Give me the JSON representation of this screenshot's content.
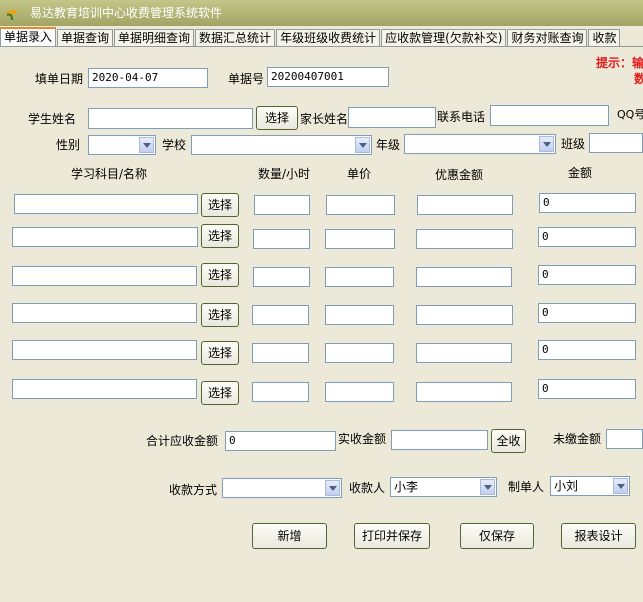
{
  "window": {
    "title": "易达教育培训中心收费管理系统软件"
  },
  "tabs": [
    "单据录入",
    "单据查询",
    "单据明细查询",
    "数据汇总统计",
    "年级班级收费统计",
    "应收款管理(欠款补交)",
    "财务对账查询",
    "收款"
  ],
  "form": {
    "date_label": "填单日期",
    "date_value": "2020-04-07",
    "receipt_label": "单据号",
    "receipt_value": "20200407001",
    "hint_line1": "提示：输",
    "hint_line2": "数",
    "student_label": "学生姓名",
    "student_value": "",
    "select_label": "选择",
    "parent_label": "家长姓名",
    "parent_value": "",
    "phone_label": "联系电话",
    "phone_value": "",
    "qq_label": "QQ号",
    "gender_label": "性别",
    "gender_value": "",
    "school_label": "学校",
    "school_value": "",
    "grade_label": "年级",
    "grade_value": "",
    "class_label": "班级",
    "class_value": ""
  },
  "items": {
    "headers": {
      "subject": "学习科目/名称",
      "qty": "数量/小时",
      "price": "单价",
      "discount": "优惠金额",
      "amount": "金额"
    },
    "rows": [
      {
        "subject": "",
        "select": "选择",
        "qty": "",
        "price": "",
        "discount": "",
        "amount": "0"
      },
      {
        "subject": "",
        "select": "选择",
        "qty": "",
        "price": "",
        "discount": "",
        "amount": "0"
      },
      {
        "subject": "",
        "select": "选择",
        "qty": "",
        "price": "",
        "discount": "",
        "amount": "0"
      },
      {
        "subject": "",
        "select": "选择",
        "qty": "",
        "price": "",
        "discount": "",
        "amount": "0"
      },
      {
        "subject": "",
        "select": "选择",
        "qty": "",
        "price": "",
        "discount": "",
        "amount": "0"
      },
      {
        "subject": "",
        "select": "选择",
        "qty": "",
        "price": "",
        "discount": "",
        "amount": "0"
      }
    ]
  },
  "totals": {
    "receivable_label": "合计应收金额",
    "receivable_value": "0",
    "received_label": "实收金额",
    "received_value": "",
    "all_button": "全收",
    "unpaid_label": "未缴金额",
    "unpaid_value": ""
  },
  "payment": {
    "method_label": "收款方式",
    "method_value": "",
    "payee_label": "收款人",
    "payee_value": "小李",
    "maker_label": "制单人",
    "maker_value": "小刘"
  },
  "actions": {
    "new": "新增",
    "print_save": "打印并保存",
    "save_only": "仅保存",
    "report_design": "报表设计"
  },
  "colors": {
    "titlebar": "#a9ab6c",
    "panel": "#ece9d8",
    "hint": "#e11d1d",
    "button_border": "#536532"
  }
}
